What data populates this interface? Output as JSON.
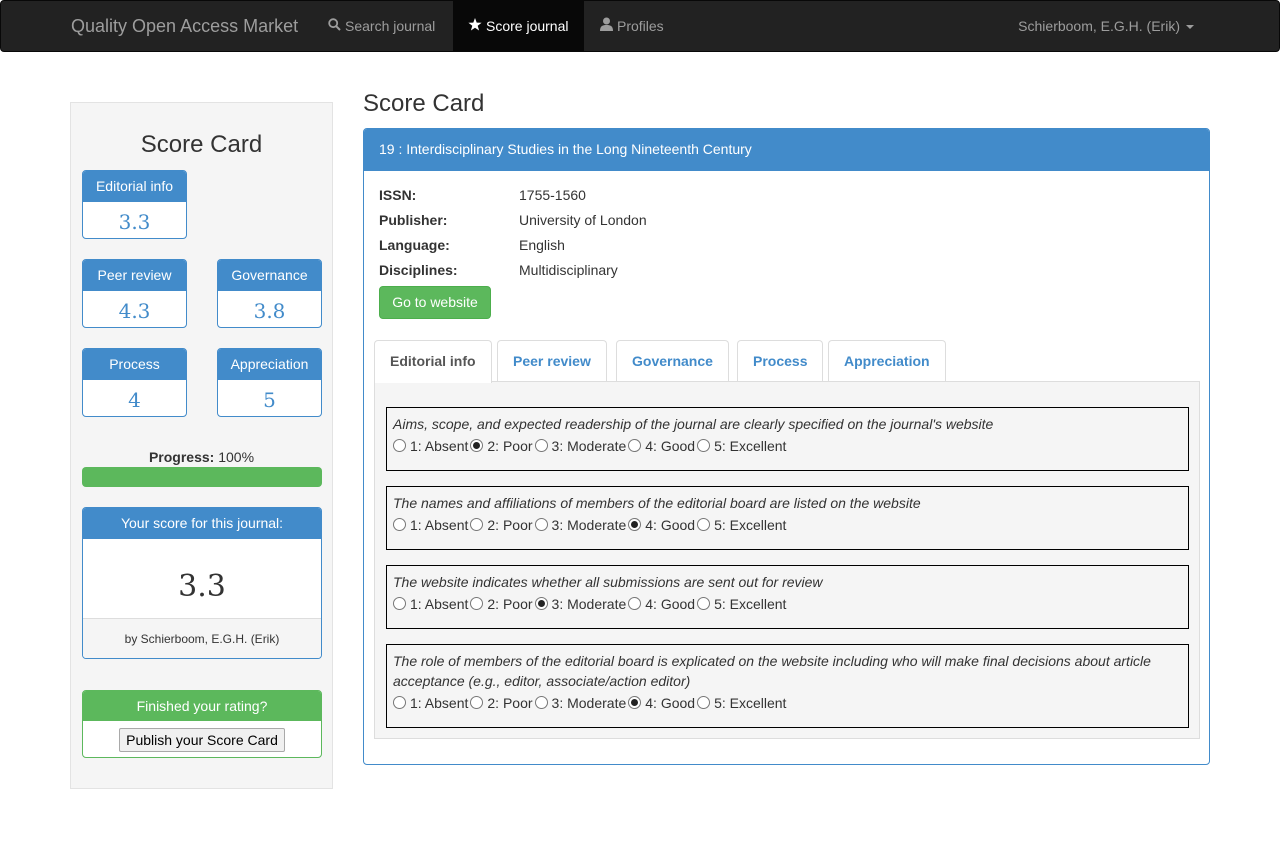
{
  "navbar": {
    "brand": "Quality Open Access Market",
    "items": [
      {
        "label": "Search journal",
        "icon": "search-icon",
        "active": false
      },
      {
        "label": "Score journal",
        "icon": "star-icon",
        "active": true
      },
      {
        "label": "Profiles",
        "icon": "user-icon",
        "active": false
      }
    ],
    "user": "Schierboom, E.G.H. (Erik)"
  },
  "sidebar": {
    "title": "Score Card",
    "scores": [
      {
        "label": "Editorial info",
        "value": "3.3"
      },
      {
        "label": "Peer review",
        "value": "4.3"
      },
      {
        "label": "Governance",
        "value": "3.8"
      },
      {
        "label": "Process",
        "value": "4"
      },
      {
        "label": "Appreciation",
        "value": "5"
      }
    ],
    "progress_label": "Progress:",
    "progress_value": "100%",
    "progress_fraction": 1.0,
    "your_score_header": "Your score for this journal:",
    "your_score_value": "3.3",
    "your_score_by": "by Schierboom, E.G.H. (Erik)",
    "finished_header": "Finished your rating?",
    "publish_label": "Publish your Score Card"
  },
  "main": {
    "title": "Score Card",
    "journal_header": "19 : Interdisciplinary Studies in the Long Nineteenth Century",
    "info": [
      {
        "key": "ISSN:",
        "value": "1755-1560"
      },
      {
        "key": "Publisher:",
        "value": "University of London"
      },
      {
        "key": "Language:",
        "value": "English"
      },
      {
        "key": "Disciplines:",
        "value": "Multidisciplinary"
      }
    ],
    "go_button": "Go to website",
    "tabs": [
      {
        "label": "Editorial info",
        "active": true
      },
      {
        "label": "Peer review",
        "active": false
      },
      {
        "label": "Governance",
        "active": false
      },
      {
        "label": "Process",
        "active": false
      },
      {
        "label": "Appreciation",
        "active": false
      }
    ],
    "options": [
      "1: Absent",
      "2: Poor",
      "3: Moderate",
      "4: Good",
      "5: Excellent"
    ],
    "questions": [
      {
        "text": "Aims, scope, and expected readership of the journal are clearly specified on the journal's website",
        "selected": 2
      },
      {
        "text": "The names and affiliations of members of the editorial board are listed on the website",
        "selected": 4
      },
      {
        "text": "The website indicates whether all submissions are sent out for review",
        "selected": 3
      },
      {
        "text": "The role of members of the editorial board is explicated on the website including who will make final decisions about article acceptance (e.g., editor, associate/action editor)",
        "selected": 4
      }
    ]
  }
}
